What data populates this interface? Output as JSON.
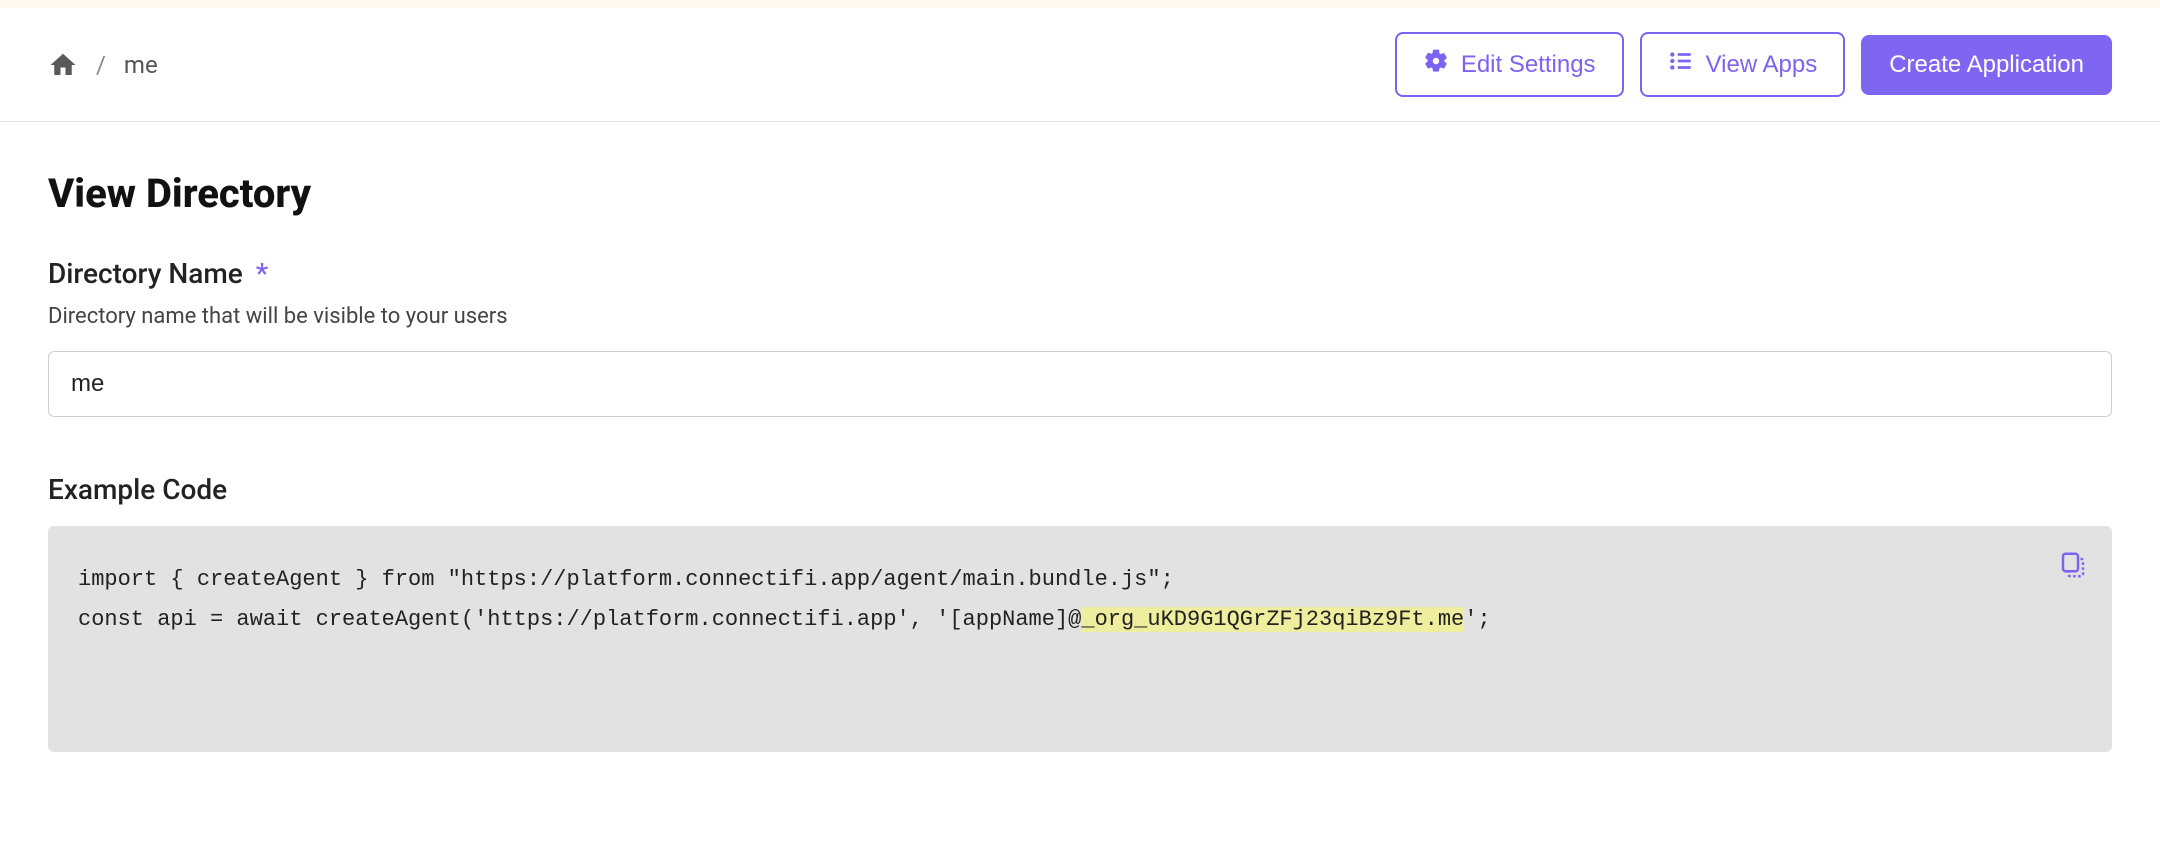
{
  "breadcrumb": {
    "current": "me"
  },
  "header": {
    "editSettings": "Edit Settings",
    "viewApps": "View Apps",
    "createApplication": "Create Application"
  },
  "page": {
    "title": "View Directory"
  },
  "directoryName": {
    "label": "Directory Name",
    "requiredMark": "*",
    "helper": "Directory name that will be visible to your users",
    "value": "me"
  },
  "exampleCode": {
    "label": "Example Code",
    "line1": "import { createAgent } from \"https://platform.connectifi.app/agent/main.bundle.js\";",
    "line2_prefix": "const api = await createAgent('https://platform.connectifi.app', '[appName]@",
    "line2_highlight": "_org_uKD9G1QGrZFj23qiBz9Ft.me",
    "line2_suffix": "';"
  }
}
